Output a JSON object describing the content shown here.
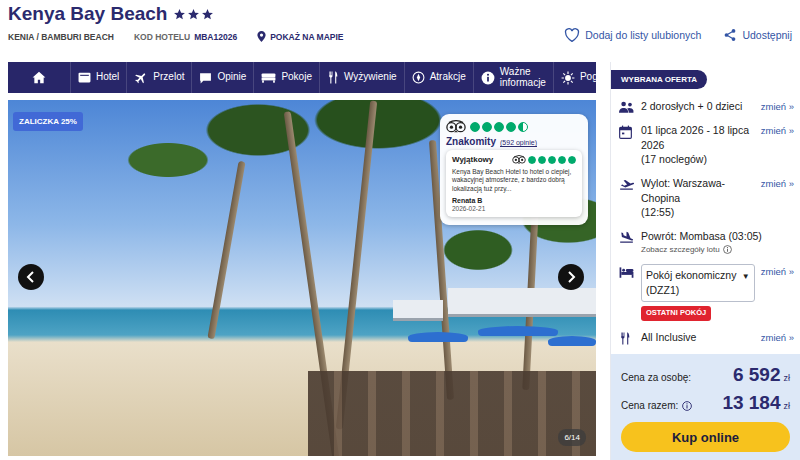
{
  "hotel": {
    "name": "Kenya Bay Beach",
    "stars": 3,
    "region": "KENIA / BAMBURI BEACH",
    "code_label": "KOD HOTELU",
    "code": "MBA12026",
    "map_link": "POKAŻ NA MAPIE"
  },
  "actions": {
    "favorite": "Dodaj do listy ulubionych",
    "share": "Udostępnij"
  },
  "nav": {
    "items": [
      "Hotel",
      "Przelot",
      "Opinie",
      "Pokoje",
      "Wyżywienie",
      "Atrakcje",
      "Ważne informacje",
      "Pogoda"
    ]
  },
  "gallery": {
    "badge": "ZALICZKA 25%",
    "counter": "6/14"
  },
  "review": {
    "stars": 4.5,
    "verdict": "Znakomity",
    "count": "(592 opinie)",
    "featured": {
      "title": "Wyjątkowy",
      "stars": 5,
      "text": "Kenya Bay Beach Hotel to hotel o ciepłej, wakacyjnej atmosferze, z bardzo dobrą lokalizacją tuż przy...",
      "author": "Renata B",
      "date": "2026-02-21"
    }
  },
  "offer": {
    "title": "WYBRANA OFERTA",
    "guests": "2 dorosłych + 0 dzieci",
    "guests_change": "zmień »",
    "dates": "01 lipca 2026 - 18 lipca 2026",
    "nights": "(17 noclegów)",
    "dates_change": "zmień »",
    "departure": "Wylot: Warszawa-Chopina",
    "departure_time": "(12:55)",
    "departure_change": "zmień »",
    "return": "Powrót: Mombasa (03:05)",
    "flight_details": "Zobacz szczegóły lotu",
    "room": "Pokój ekonomiczny (DZZ1)",
    "room_arrow": "▼",
    "room_badge": "OSTATNI POKÓJ",
    "room_change": "zmień »",
    "board": "All Inclusive",
    "board_change": "zmień »"
  },
  "price": {
    "per_person_label": "Cena za osobę:",
    "per_person": "6 592",
    "per_person_currency": "zł",
    "total_label": "Cena razem:",
    "total": "13 184",
    "total_currency": "zł",
    "buy": "Kup online"
  }
}
